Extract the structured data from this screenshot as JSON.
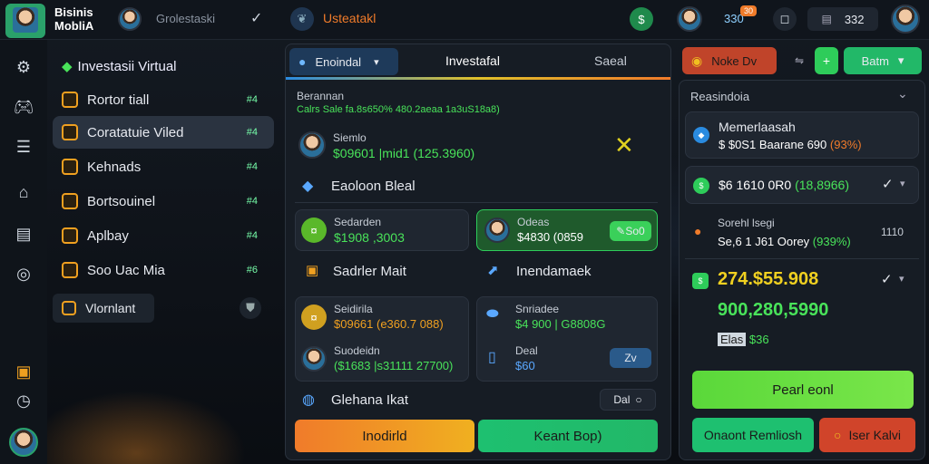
{
  "brand": {
    "line1": "Bisinis",
    "line2": "MobliA"
  },
  "header": {
    "search_text": "Grolestaski",
    "center_title": "Usteatakl",
    "badge_value": "30",
    "counter": "330",
    "status_value": "332"
  },
  "nav": {
    "title": "Investasii Virtual",
    "items": [
      {
        "label": "Rortor tiall",
        "count": "#4"
      },
      {
        "label": "Coratatuie Viled",
        "count": "#4"
      },
      {
        "label": "Kehnads",
        "count": "#4"
      },
      {
        "label": "Bortsouinel",
        "count": "#4"
      },
      {
        "label": "Aplbay",
        "count": "#4"
      },
      {
        "label": "Soo Uac Mia",
        "count": "#6"
      }
    ],
    "special": "Vlornlant"
  },
  "center": {
    "tabs": {
      "dropdown": "Enoindal",
      "active": "Investafal",
      "third": "Saeal"
    },
    "section_label": "Berannan",
    "section_sub": "Calrs Sale fa.8s650% 480.2aeaa 1a3uS18a8)",
    "row1_title": "Siemlo",
    "row1_value": "$09601 |mid1 (125.3960)",
    "row2_label": "Eaoloon Bleal",
    "card_a_title": "Sedarden",
    "card_a_value": "$1908 ,3003",
    "card_b_title": "Odeas",
    "card_b_value": "$4830 (0859",
    "card_b_btn": "So0",
    "mid_left": "Sadrler Mait",
    "mid_right": "Inendamaek",
    "card_c_title": "Seidirila",
    "card_c_value": "$09661 (e360.7 088)",
    "card_c2_title": "Suodeidn",
    "card_c2_value": "($1683 |s31111 27700)",
    "card_d_title": "Snriadee",
    "card_d_value": "$4 900 | G8808G",
    "card_d2_title": "Deal",
    "card_d2_value": "$60",
    "card_d2_btn": "Zv",
    "bottom_label": "Glehana Ikat",
    "bottom_btn": "Dal",
    "btn_orange": "Inodirld",
    "btn_green": "Keant Bop)"
  },
  "right": {
    "top_btn_orange": "Noke Dv",
    "top_btn_green": "Batm",
    "panel_title": "Reasindoia",
    "item1_title": "Memerlaasah",
    "item1_value": "$ $0S1 Baarane 690",
    "item1_pct": "(93%)",
    "item2_value": "$6 1610 0R0",
    "item2_pct": "(18,8966)",
    "item3_title": "Sorehl lsegi",
    "item3_value": "Se,6 1 J61 Oorey",
    "item3_pct": "(939%)",
    "item3_side": "1110",
    "big_value": "274.$55.908",
    "big_value2": "900,280,5990",
    "tag_label": "Elas",
    "tag_value": "$36",
    "btn_main": "Pearl eonl",
    "btn_left": "Onaont Remliosh",
    "btn_right": "Iser Kalvi"
  },
  "colors": {
    "accent_green": "#2ecc5a",
    "accent_orange": "#f0902a",
    "accent_blue": "#2a8be0"
  }
}
